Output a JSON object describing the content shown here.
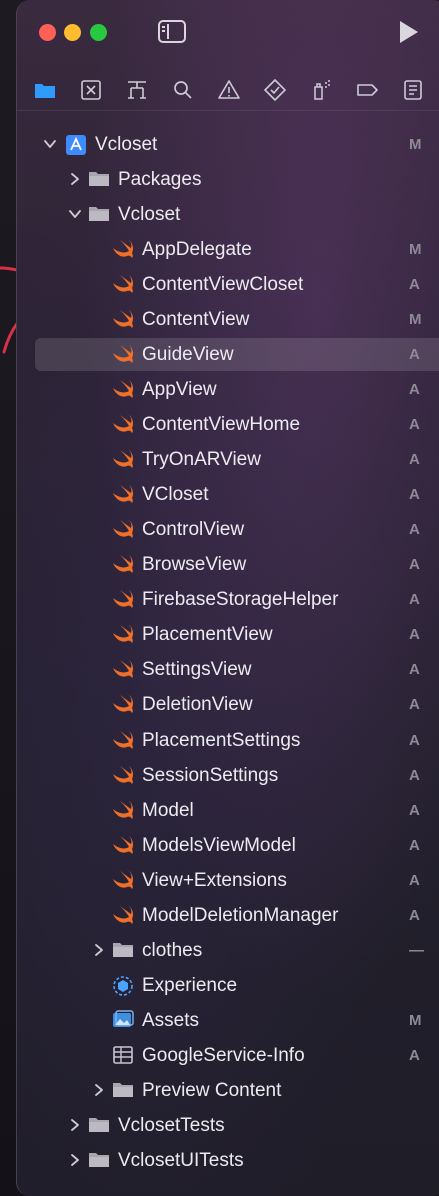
{
  "window": {
    "controls": [
      "close",
      "minimize",
      "maximize"
    ],
    "toolbar_icons": [
      {
        "name": "folder-icon",
        "color": "#2f9bff"
      },
      {
        "name": "source-control-icon"
      },
      {
        "name": "symbol-hierarchy-icon"
      },
      {
        "name": "search-icon"
      },
      {
        "name": "warning-icon"
      },
      {
        "name": "test-diamond-icon"
      },
      {
        "name": "debug-spray-icon"
      },
      {
        "name": "breakpoint-icon"
      },
      {
        "name": "report-icon"
      }
    ]
  },
  "tree": [
    {
      "label": "Vcloset",
      "status": "M",
      "type": "project",
      "expanded": true,
      "level": 0
    },
    {
      "label": "Packages",
      "status": "",
      "type": "folder",
      "expanded": false,
      "level": 1
    },
    {
      "label": "Vcloset",
      "status": "",
      "type": "folder",
      "expanded": true,
      "level": 1
    },
    {
      "label": "AppDelegate",
      "status": "M",
      "type": "swift",
      "level": 2
    },
    {
      "label": "ContentViewCloset",
      "status": "A",
      "type": "swift",
      "level": 2
    },
    {
      "label": "ContentView",
      "status": "M",
      "type": "swift",
      "level": 2
    },
    {
      "label": "GuideView",
      "status": "A",
      "type": "swift",
      "level": 2,
      "selected": true
    },
    {
      "label": "AppView",
      "status": "A",
      "type": "swift",
      "level": 2
    },
    {
      "label": "ContentViewHome",
      "status": "A",
      "type": "swift",
      "level": 2
    },
    {
      "label": "TryOnARView",
      "status": "A",
      "type": "swift",
      "level": 2
    },
    {
      "label": "VCloset",
      "status": "A",
      "type": "swift",
      "level": 2
    },
    {
      "label": "ControlView",
      "status": "A",
      "type": "swift",
      "level": 2
    },
    {
      "label": "BrowseView",
      "status": "A",
      "type": "swift",
      "level": 2
    },
    {
      "label": "FirebaseStorageHelper",
      "status": "A",
      "type": "swift",
      "level": 2
    },
    {
      "label": "PlacementView",
      "status": "A",
      "type": "swift",
      "level": 2
    },
    {
      "label": "SettingsView",
      "status": "A",
      "type": "swift",
      "level": 2
    },
    {
      "label": "DeletionView",
      "status": "A",
      "type": "swift",
      "level": 2
    },
    {
      "label": "PlacementSettings",
      "status": "A",
      "type": "swift",
      "level": 2
    },
    {
      "label": "SessionSettings",
      "status": "A",
      "type": "swift",
      "level": 2
    },
    {
      "label": "Model",
      "status": "A",
      "type": "swift",
      "level": 2
    },
    {
      "label": "ModelsViewModel",
      "status": "A",
      "type": "swift",
      "level": 2
    },
    {
      "label": "View+Extensions",
      "status": "A",
      "type": "swift",
      "level": 2
    },
    {
      "label": "ModelDeletionManager",
      "status": "A",
      "type": "swift",
      "level": 2
    },
    {
      "label": "clothes",
      "status": "—",
      "type": "folder",
      "expanded": false,
      "level": 2
    },
    {
      "label": "Experience",
      "status": "",
      "type": "reality",
      "level": 2
    },
    {
      "label": "Assets",
      "status": "M",
      "type": "assets",
      "level": 2
    },
    {
      "label": "GoogleService-Info",
      "status": "A",
      "type": "plist",
      "level": 2
    },
    {
      "label": "Preview Content",
      "status": "",
      "type": "folder",
      "expanded": false,
      "level": 2
    },
    {
      "label": "VclosetTests",
      "status": "",
      "type": "folder",
      "expanded": false,
      "level": 1
    },
    {
      "label": "VclosetUITests",
      "status": "",
      "type": "folder",
      "expanded": false,
      "level": 1
    }
  ],
  "colors": {
    "swift_icon": "#f0702a",
    "folder_icon": "#a9a5ae",
    "project_icon": "#3d8bfd",
    "annotation": "#d8324a",
    "status": "#8e8a95"
  }
}
